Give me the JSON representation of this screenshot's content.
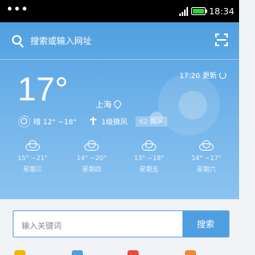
{
  "status_bar": {
    "dots": "•••",
    "time": "18:34",
    "battery_color": "#35d03c"
  },
  "header": {
    "search_placeholder": "搜索或输入网址",
    "search_icon": "search-icon",
    "scan_icon": "scan-icon"
  },
  "weather": {
    "update_time": "17:20 更新",
    "temperature": "17°",
    "city": "上海",
    "condition": "晴 12° ~18°",
    "wind": "1级微风",
    "aqi_badge": "62 良 >"
  },
  "forecast": [
    {
      "range": "15° ~21°",
      "day": "星期三",
      "icon": "cloud-icon"
    },
    {
      "range": "14° ~20°",
      "day": "星期四",
      "icon": "cloud-icon"
    },
    {
      "range": "13° ~18°",
      "day": "星期五",
      "icon": "cloud-icon"
    },
    {
      "range": "14° ~17°",
      "day": "星期六",
      "icon": "cloud-icon"
    }
  ],
  "search": {
    "placeholder": "输入关键词",
    "button": "搜索"
  },
  "colors": {
    "accent": "#4f9fe0",
    "shortcut_colors": [
      "#f4b400",
      "#4f9fe0",
      "#e84a3c",
      "#f08a2e"
    ]
  }
}
